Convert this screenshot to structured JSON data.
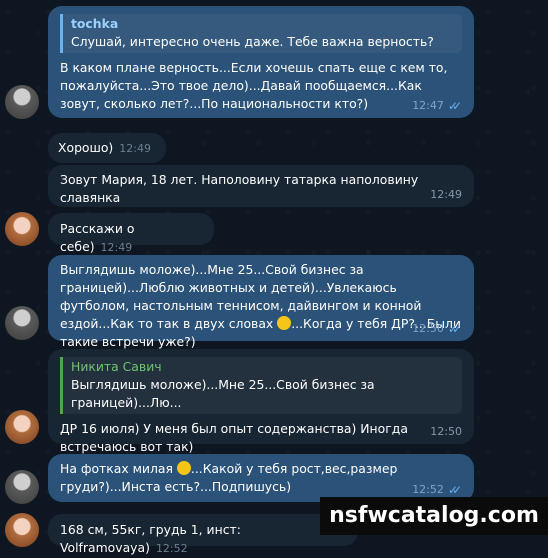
{
  "messages": [
    {
      "quote_author": "tochka",
      "quote_text": "Слушай, интересно очень даже. Тебе важна верность?",
      "text": "В каком плане верность...Если хочешь спать еще с кем то, пожалуйста...Это твое дело)...Давай пообщаемся...Как зовут, сколько лет?...По национальности кто?)",
      "time": "12:47"
    },
    {
      "text": "Хорошо)",
      "time": "12:49"
    },
    {
      "text": "Зовут Мария, 18 лет. Наполовину татарка наполовину славянка",
      "time": "12:49"
    },
    {
      "text": "Расскажи о себе)",
      "time": "12:49"
    },
    {
      "text_a": "Выглядишь моложе)...Мне 25...Свой бизнес за границей)...Люблю животных и детей)...Увлекаюсь футболом, настольным теннисом, дайвингом и конной ездой...Как то так в двух словах",
      "emoji": "smile-emoji",
      "text_b": "...Когда у тебя ДР?...Были такие встречи уже?)",
      "time": "12:50"
    },
    {
      "quote_author": "Никита Савич",
      "quote_text": "Выглядишь моложе)...Мне 25...Свой бизнес за границей)...Лю...",
      "text": "ДР 16 июля) У меня был опыт содержанства) Иногда встречаюсь вот так)",
      "time": "12:50"
    },
    {
      "text_a": "На фотках милая",
      "emoji": "heart-eyes-emoji",
      "text_b": "...Какой у тебя рост,вес,размер груди?)...Инста есть?...Подпишусь)",
      "time": "12:52"
    },
    {
      "text": "168 см, 55кг, грудь 1, инст: Volframovaya)",
      "time": "12:52"
    }
  ],
  "watermark": "nsfwcatalog.com",
  "colors": {
    "background": "#0e1621",
    "incoming": "#182533",
    "outgoing": "#2b5278",
    "accent": "#6ab2f2"
  }
}
